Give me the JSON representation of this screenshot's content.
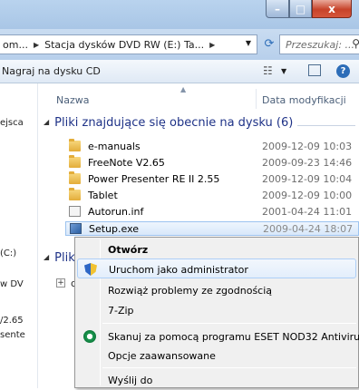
{
  "window": {
    "buttons": {
      "minimize": "–",
      "maximize": "□",
      "close": "x"
    }
  },
  "address": {
    "crumbs": [
      "om...",
      "Stacja dysków DVD RW (E:) Ta..."
    ],
    "search_placeholder": "Przeszukaj: ..."
  },
  "toolbar": {
    "burn_label": "Nagraj na dysku CD"
  },
  "nav": {
    "items": [
      "ejsca",
      "(C:)",
      "w DV",
      "/2.65",
      "sente"
    ]
  },
  "columns": {
    "name": "Nazwa",
    "date": "Data modyfikacji"
  },
  "groups": {
    "current": "Pliki znajdujące się obecnie na dysku (6)",
    "pending": "Pliki"
  },
  "files": [
    {
      "name": "e-manuals",
      "date": "2009-12-09 10:03",
      "icon": "folder-icon"
    },
    {
      "name": "FreeNote V2.65",
      "date": "2009-09-23 14:46",
      "icon": "folder-icon"
    },
    {
      "name": "Power Presenter RE II 2.55",
      "date": "2009-12-09 10:04",
      "icon": "folder-icon"
    },
    {
      "name": "Tablet",
      "date": "2009-12-09 10:00",
      "icon": "folder-icon"
    },
    {
      "name": "Autorun.inf",
      "date": "2001-04-24 11:01",
      "icon": "inf-icon"
    },
    {
      "name": "Setup.exe",
      "date": "2009-04-24 18:07",
      "icon": "exe-icon"
    }
  ],
  "pending_files": [
    {
      "name": "des"
    }
  ],
  "context_menu": {
    "open": "Otwórz",
    "run_as_admin": "Uruchom jako administrator",
    "troubleshoot": "Rozwiąż problemy ze zgodnością",
    "zip": "7-Zip",
    "eset_scan": "Skanuj za pomocą programu ESET NOD32 Antivirus",
    "advanced": "Opcje zaawansowane",
    "send_to": "Wyślij do"
  }
}
